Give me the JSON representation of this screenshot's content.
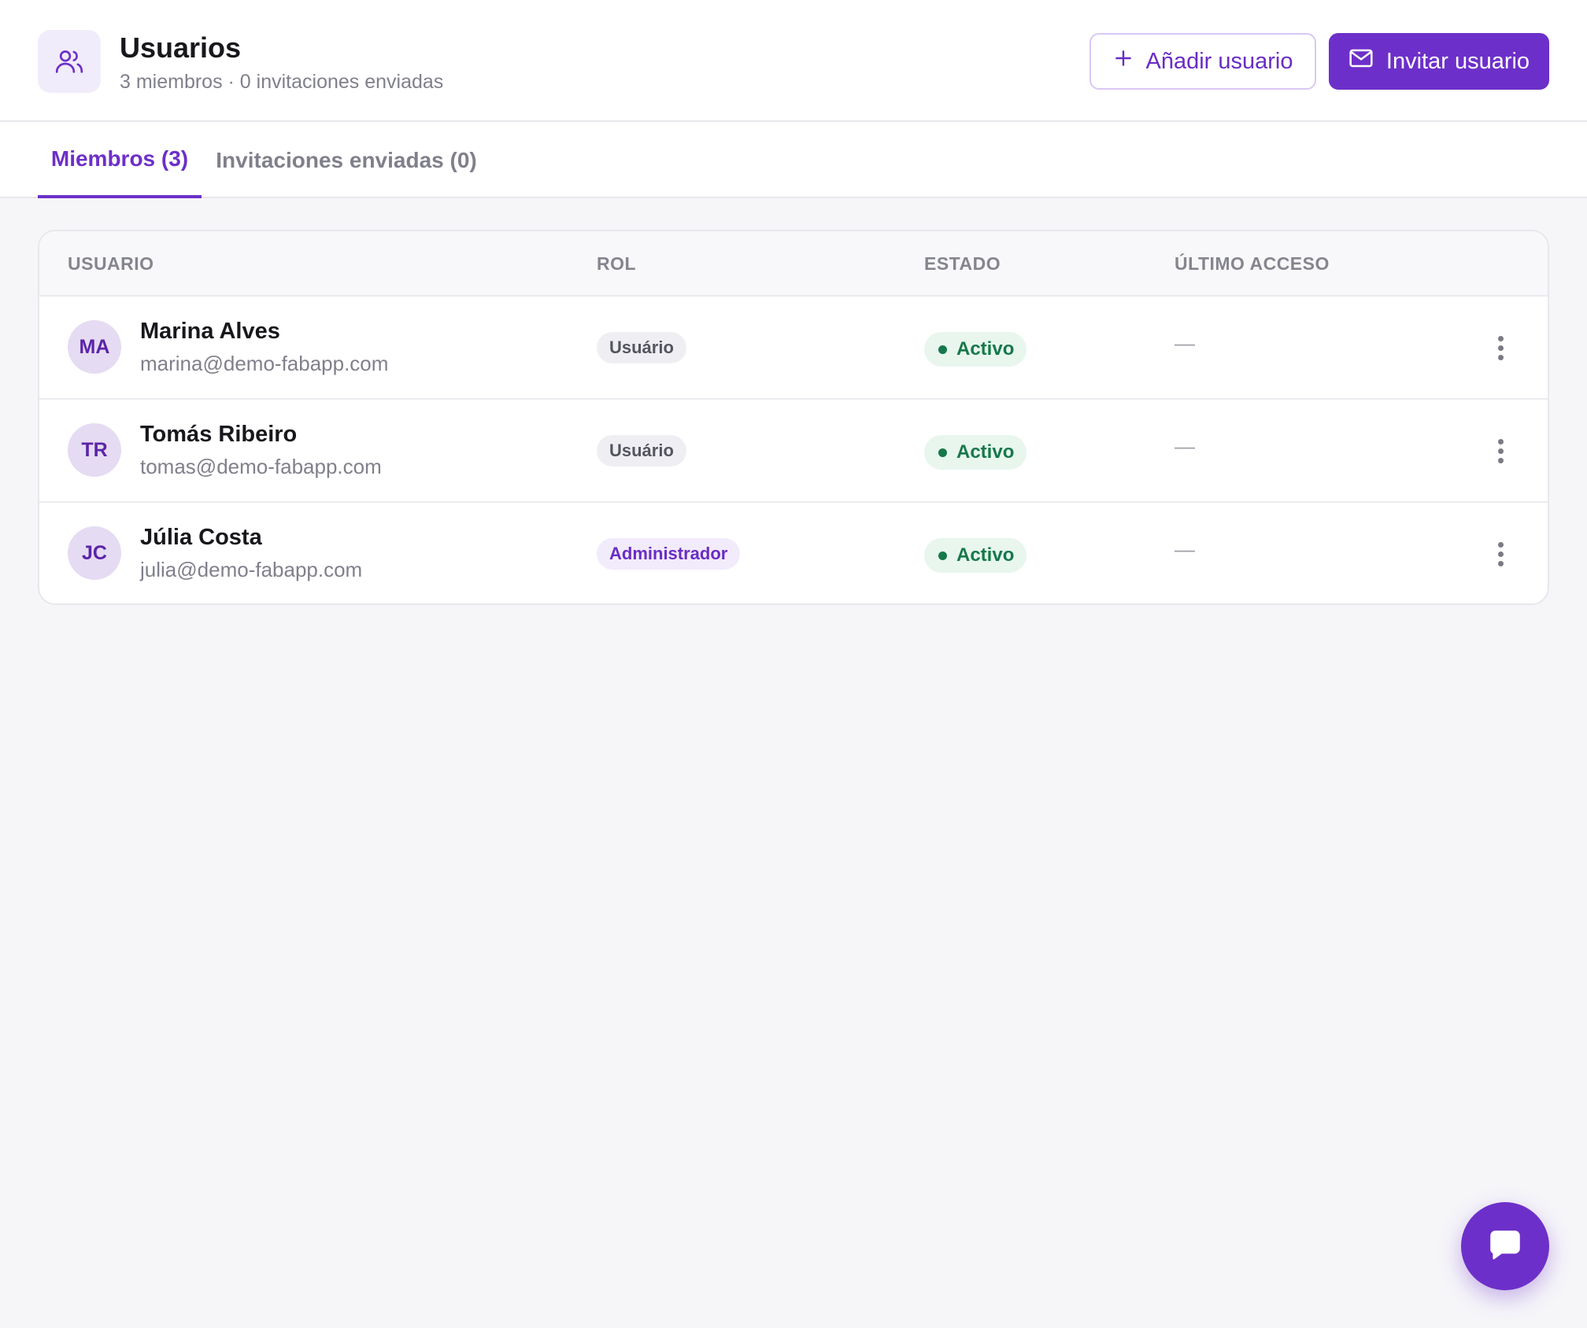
{
  "header": {
    "icon": "users-icon",
    "title": "Usuarios",
    "subtitle": "3 miembros · 0 invitaciones enviadas",
    "add_user_label": "Añadir usuario",
    "invite_user_label": "Invitar usuario"
  },
  "tabs": [
    {
      "label": "Miembros (3)",
      "active": true
    },
    {
      "label": "Invitaciones enviadas (0)",
      "active": false
    }
  ],
  "table": {
    "columns": [
      "USUARIO",
      "ROL",
      "ESTADO",
      "ÚLTIMO ACCESO"
    ],
    "rows": [
      {
        "initials": "MA",
        "name": "Marina Alves",
        "email": "marina@demo-fabapp.com",
        "role": "Usuário",
        "status": "Activo",
        "last_access": "—"
      },
      {
        "initials": "TR",
        "name": "Tomás Ribeiro",
        "email": "tomas@demo-fabapp.com",
        "role": "Usuário",
        "status": "Activo",
        "last_access": "—"
      },
      {
        "initials": "JC",
        "name": "Júlia Costa",
        "email": "julia@demo-fabapp.com",
        "role": "Administrador",
        "status": "Activo",
        "last_access": "—"
      }
    ]
  },
  "colors": {
    "accent": "#6d2fc9",
    "status_active": "#16784a",
    "status_active_bg": "#e8f6ee"
  }
}
